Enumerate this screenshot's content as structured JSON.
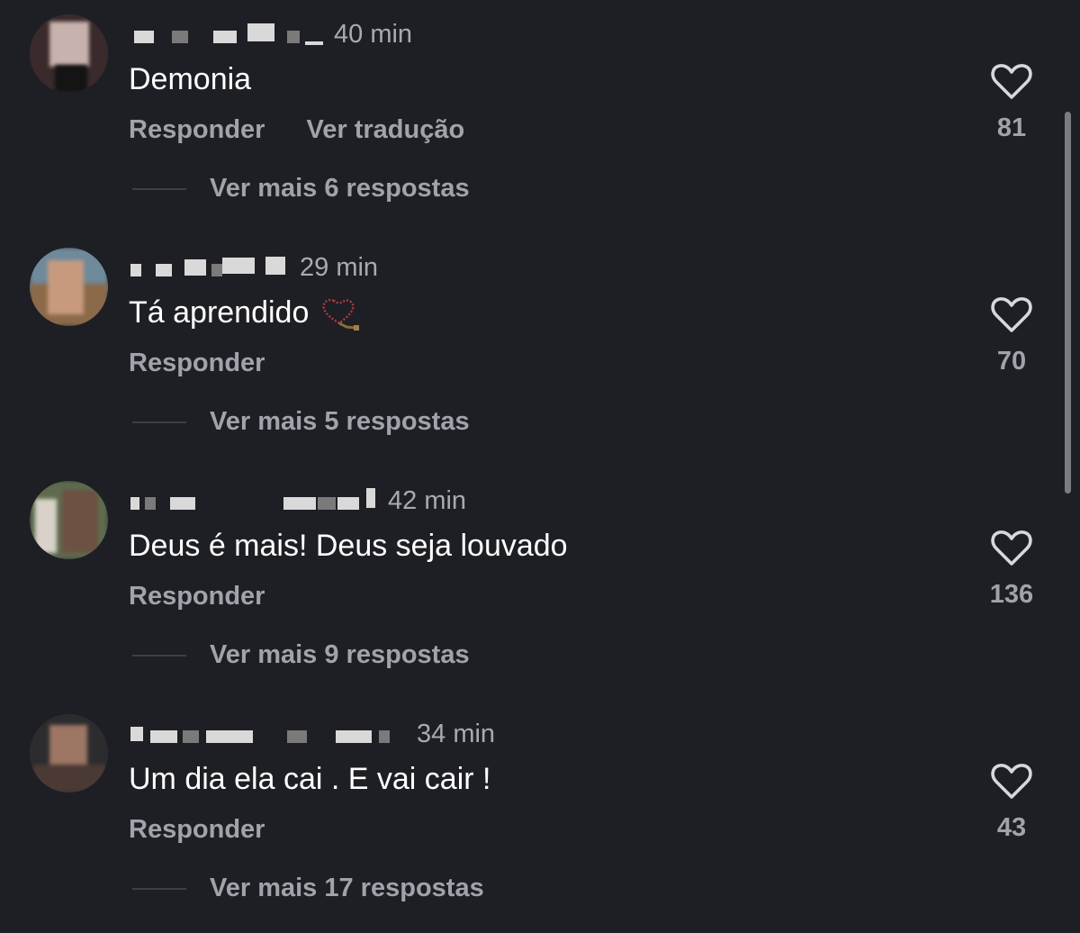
{
  "comments": [
    {
      "time": "40 min",
      "text": "Demonia",
      "reply_label": "Responder",
      "translate_label": "Ver tradução",
      "replies_label": "Ver mais 6 respostas",
      "likes": "81"
    },
    {
      "time": "29 min",
      "text": "Tá aprendido",
      "reply_label": "Responder",
      "replies_label": "Ver mais 5 respostas",
      "likes": "70"
    },
    {
      "time": "42 min",
      "text": "Deus é mais! Deus seja louvado",
      "reply_label": "Responder",
      "replies_label": "Ver mais 9 respostas",
      "likes": "136"
    },
    {
      "time": "34 min",
      "text": "Um dia ela cai . E vai cair !",
      "reply_label": "Responder",
      "replies_label": "Ver mais 17 respostas",
      "likes": "43"
    }
  ],
  "colors": {
    "background": "#1e1f24",
    "text": "#ffffff",
    "secondary": "#a1a3ab",
    "heart": "#d7d8dc"
  }
}
